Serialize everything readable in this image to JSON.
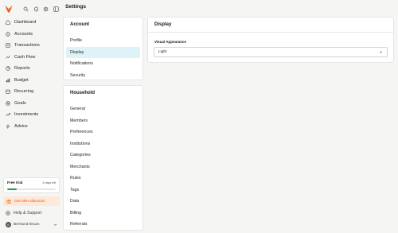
{
  "sidebar": {
    "logo_icon": "bird-logo-icon",
    "nav": [
      {
        "label": "Dashboard",
        "icon": "home-icon"
      },
      {
        "label": "Accounts",
        "icon": "accounts-icon"
      },
      {
        "label": "Transactions",
        "icon": "transactions-icon"
      },
      {
        "label": "Cash Flow",
        "icon": "cash-flow-icon"
      },
      {
        "label": "Reports",
        "icon": "reports-icon"
      },
      {
        "label": "Budget",
        "icon": "budget-icon"
      },
      {
        "label": "Recurring",
        "icon": "recurring-icon"
      },
      {
        "label": "Goals",
        "icon": "goals-icon"
      },
      {
        "label": "Investments",
        "icon": "investments-icon"
      },
      {
        "label": "Advice",
        "icon": "advice-icon"
      }
    ],
    "trial": {
      "title": "Free trial",
      "days_left": "6 days left",
      "progress": 0.2,
      "bar_color": "#16a34a"
    },
    "discount": {
      "label": "Get 40% discount",
      "color": "#ea580c",
      "bg": "#fde8d9"
    },
    "help": {
      "label": "Help & Support"
    },
    "user": {
      "initial": "B",
      "name": "Bertrand Bruan"
    }
  },
  "header": {
    "title": "Settings"
  },
  "account": {
    "title": "Account",
    "items": [
      "Profile",
      "Display",
      "Notifications",
      "Security"
    ],
    "active": "Display"
  },
  "household": {
    "title": "Household",
    "items": [
      "General",
      "Members",
      "Preferences",
      "Institutions",
      "Categories",
      "Merchants",
      "Rules",
      "Tags",
      "Data",
      "Billing",
      "Referrals"
    ]
  },
  "display": {
    "title": "Display",
    "visual_appearance_label": "Visual Appearance",
    "visual_appearance_value": "Light"
  },
  "colors": {
    "active_bg": "#dff2f7",
    "accent": "#ea580c"
  }
}
